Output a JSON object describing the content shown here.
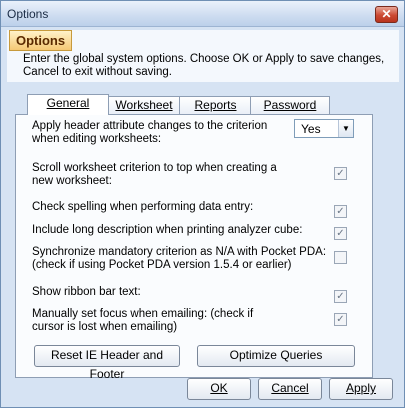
{
  "window": {
    "title": "Options"
  },
  "header": {
    "title": "Options",
    "description": "Enter the global system options. Choose OK or Apply to save changes, Cancel to exit without saving."
  },
  "tabs": [
    {
      "label": "General",
      "active": true
    },
    {
      "label": "Worksheet",
      "active": false
    },
    {
      "label": "Reports",
      "active": false
    },
    {
      "label": "Password",
      "active": false
    }
  ],
  "general": {
    "apply_header": {
      "label": "Apply header attribute changes to the criterion when editing worksheets:",
      "value": "Yes"
    },
    "scroll_top": {
      "label": "Scroll worksheet criterion to top when creating a new worksheet:",
      "checked": true
    },
    "check_spelling": {
      "label": "Check spelling when performing data entry:",
      "checked": true
    },
    "long_description": {
      "label": "Include long description when printing analyzer cube:",
      "checked": true
    },
    "sync_mandatory": {
      "label": "Synchronize mandatory criterion as N/A with Pocket PDA: (check if using Pocket PDA version 1.5.4 or earlier)",
      "checked": false
    },
    "ribbon_bar": {
      "label": "Show ribbon bar text:",
      "checked": true
    },
    "set_focus": {
      "label": "Manually set focus when emailing: (check if cursor is lost when emailing)",
      "checked": true
    },
    "reset_button": "Reset IE Header and Footer",
    "optimize_button": "Optimize Queries"
  },
  "buttons": {
    "ok": "OK",
    "cancel": "Cancel",
    "apply": "Apply"
  },
  "check_glyph": "✓",
  "close_glyph": "✕",
  "arrow_glyph": "▼"
}
